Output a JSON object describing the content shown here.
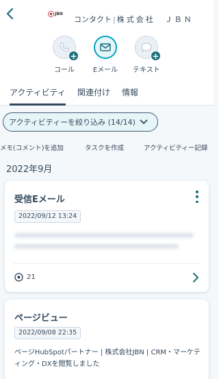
{
  "header": {
    "logo_text": "JBN",
    "object_type": "コンタクト",
    "company": "株式会社　ＪＢＮ"
  },
  "actions": [
    {
      "label": "コール",
      "icon": "phone-icon"
    },
    {
      "label": "Eメール",
      "icon": "mail-icon"
    },
    {
      "label": "テキスト",
      "icon": "chat-icon"
    }
  ],
  "tabs": [
    "アクティビティ",
    "関連付け",
    "情報"
  ],
  "filter": {
    "label": "アクティビティーを絞り込み (14/14)"
  },
  "quick_actions": [
    "メモ(コメント)を追加",
    "タスクを作成",
    "アクティビティー記録"
  ],
  "month_header": "2022年9月",
  "cards": [
    {
      "title": "受信Eメール",
      "date": "2022/09/12 13:24",
      "count": "21"
    },
    {
      "title": "ページビュー",
      "date": "2022/09/08 22:35",
      "description": "ページHubSpotパートナー | 株式会社JBN | CRM・マーケティング・DXを閲覧しました"
    }
  ],
  "colors": {
    "accent": "#00a4bd",
    "teal_dark": "#1b6f7a",
    "text": "#33475b",
    "background": "#f5f8fa"
  }
}
